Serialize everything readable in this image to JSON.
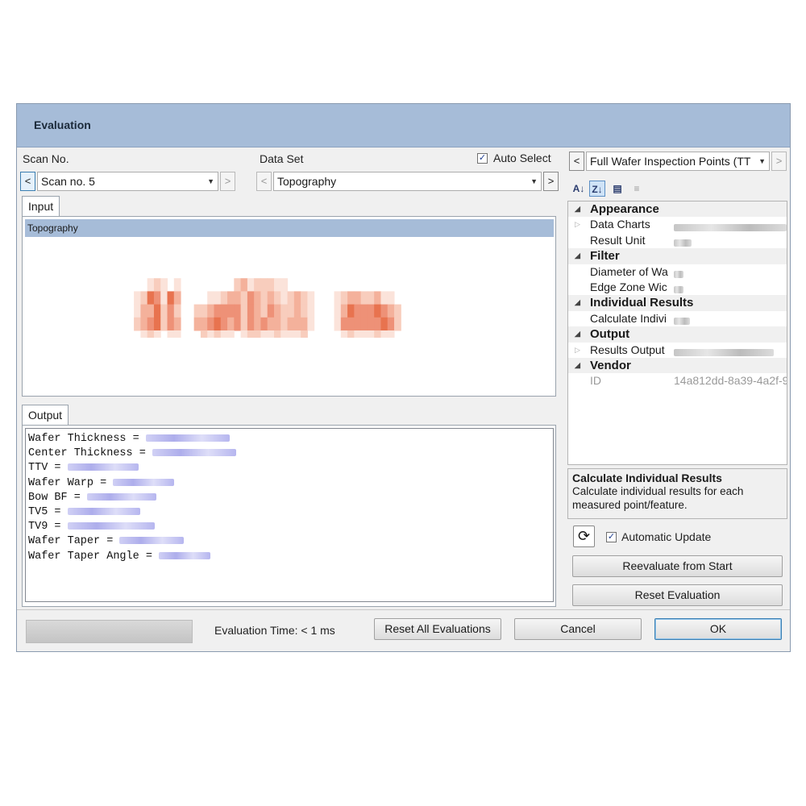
{
  "window": {
    "title": "Evaluation"
  },
  "scan": {
    "label": "Scan No.",
    "selected": "Scan no. 5",
    "prev": "<",
    "next": ">"
  },
  "dataset": {
    "label": "Data Set",
    "selected": "Topography",
    "prev": "<",
    "next": ">",
    "auto_select_label": "Auto Select",
    "auto_select_checked": true
  },
  "input": {
    "tab": "Input",
    "items": [
      "Topography"
    ]
  },
  "output": {
    "tab": "Output",
    "lines": [
      "Wafer Thickness =",
      "Center Thickness =",
      "TTV =",
      "Wafer Warp =",
      "Bow BF =",
      "TV5 =",
      "TV9 =",
      "Wafer Taper =",
      "Wafer Taper Angle ="
    ]
  },
  "properties": {
    "selector": "Full Wafer Inspection Points (TT",
    "prev": "<",
    "next": ">",
    "categories": [
      {
        "name": "Appearance",
        "rows": [
          {
            "name": "Data Charts",
            "expandable": true
          },
          {
            "name": "Result Unit",
            "expandable": false
          }
        ]
      },
      {
        "name": "Filter",
        "rows": [
          {
            "name": "Diameter of Wa",
            "expandable": false
          },
          {
            "name": "Edge Zone Wic",
            "expandable": false
          }
        ]
      },
      {
        "name": "Individual Results",
        "rows": [
          {
            "name": "Calculate Indivi",
            "expandable": false
          }
        ]
      },
      {
        "name": "Output",
        "rows": [
          {
            "name": "Results Output",
            "expandable": true
          }
        ]
      },
      {
        "name": "Vendor",
        "rows": [
          {
            "name": "ID",
            "value": "14a812dd-8a39-4a2f-9",
            "expandable": false
          }
        ]
      }
    ],
    "description_title": "Calculate Individual Results",
    "description_text": "Calculate individual results for each measured point/feature."
  },
  "controls": {
    "automatic_update_label": "Automatic Update",
    "automatic_update_checked": true,
    "reevaluate_label": "Reevaluate from Start",
    "reset_evaluation_label": "Reset Evaluation"
  },
  "footer": {
    "evaluation_time": "Evaluation Time: < 1 ms",
    "reset_all_label": "Reset All Evaluations",
    "cancel_label": "Cancel",
    "ok_label": "OK"
  },
  "colors": {
    "titlebar": "#a6bcd8",
    "selection": "#a6bcd8",
    "heatmap_dark": "#e8734f",
    "heatmap_light": "#fbe3da"
  }
}
